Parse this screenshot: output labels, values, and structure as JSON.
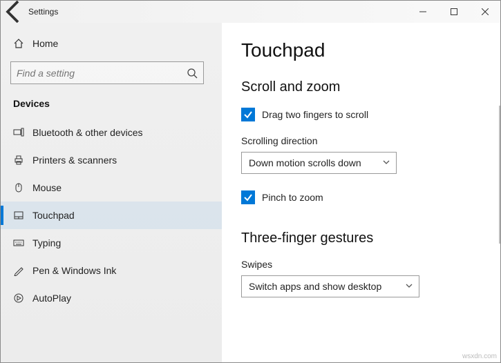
{
  "titlebar": {
    "title": "Settings"
  },
  "sidebar": {
    "home": "Home",
    "search_placeholder": "Find a setting",
    "section": "Devices",
    "items": [
      {
        "label": "Bluetooth & other devices"
      },
      {
        "label": "Printers & scanners"
      },
      {
        "label": "Mouse"
      },
      {
        "label": "Touchpad"
      },
      {
        "label": "Typing"
      },
      {
        "label": "Pen & Windows Ink"
      },
      {
        "label": "AutoPlay"
      }
    ]
  },
  "main": {
    "heading": "Touchpad",
    "scroll_zoom": {
      "title": "Scroll and zoom",
      "drag_scroll": "Drag two fingers to scroll",
      "direction_label": "Scrolling direction",
      "direction_value": "Down motion scrolls down",
      "pinch_zoom": "Pinch to zoom"
    },
    "three_finger": {
      "title": "Three-finger gestures",
      "swipes_label": "Swipes",
      "swipes_value": "Switch apps and show desktop"
    }
  },
  "watermark": "wsxdn.com"
}
